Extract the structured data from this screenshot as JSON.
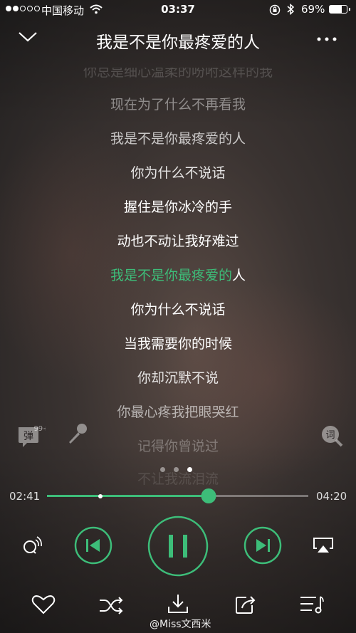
{
  "status_bar": {
    "carrier": "中国移动",
    "time": "03:37",
    "battery_pct": "69%",
    "battery_level": 0.69,
    "signal_strength": 2,
    "signal_total": 5
  },
  "header": {
    "title": "我是不是你最疼爱的人"
  },
  "lyrics": {
    "lines": [
      "你总是细心温柔的吩咐这样的我",
      "现在为了什么不再看我",
      "我是不是你最疼爱的人",
      "你为什么不说话",
      "握住是你冰冷的手",
      "动也不动让我好难过",
      "你为什么不说话",
      "当我需要你的时候",
      "你却沉默不说",
      "你最心疼我把眼哭红",
      "记得你曾说过",
      "不让我流泪流"
    ],
    "current_sung": "我是不是你最疼爱的",
    "current_rest": "人"
  },
  "side": {
    "danmu_label": "弹",
    "danmu_badge": "99+",
    "ci_label": "词"
  },
  "pager": {
    "count": 3,
    "active": 2
  },
  "progress": {
    "elapsed": "02:41",
    "total": "04:20",
    "played_fraction": 0.619,
    "buffered_fraction": 0.205
  },
  "watermark": "@Miss文西米",
  "colors": {
    "accent": "#3dbd79"
  }
}
